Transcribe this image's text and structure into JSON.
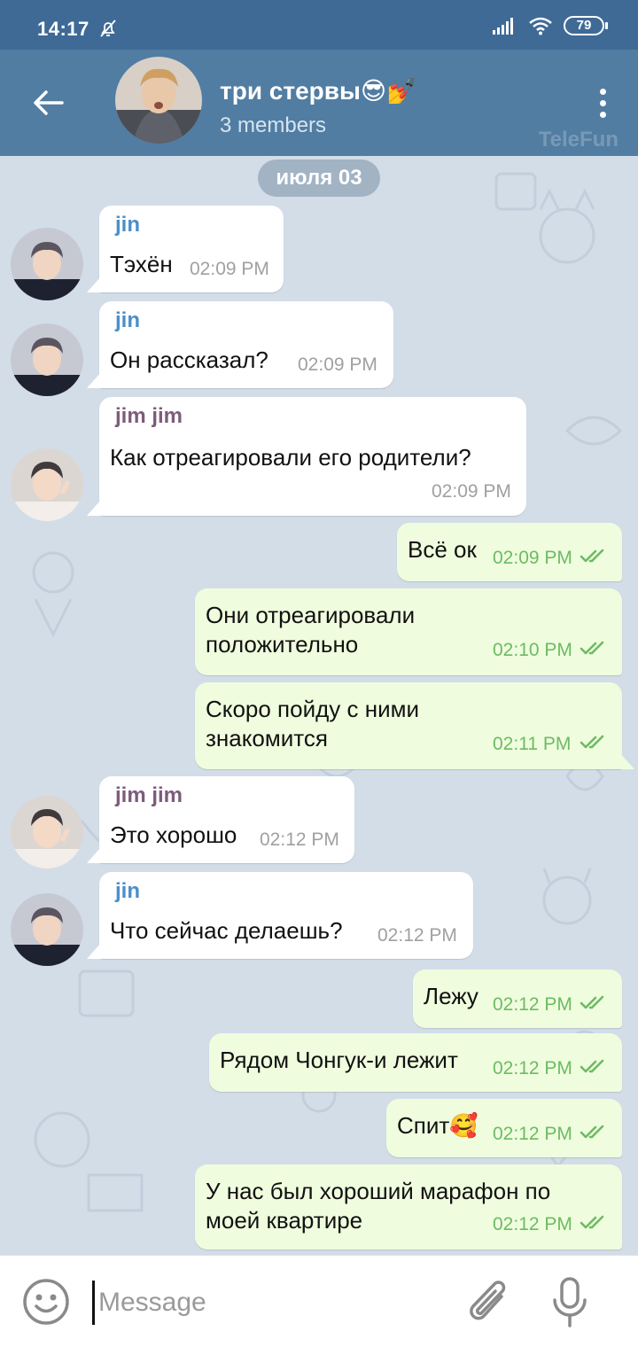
{
  "status_bar": {
    "time": "14:17",
    "battery": "79"
  },
  "header": {
    "title": "три стервы😎💅",
    "subtitle": "3 members",
    "watermark": "TeleFun"
  },
  "chat": {
    "date": "июля 03",
    "messages": [
      {
        "sender": "jin",
        "text": "Тэхён",
        "time": "02:09 PM"
      },
      {
        "sender": "jin",
        "text": "Он рассказал?",
        "time": "02:09 PM"
      },
      {
        "sender": "jim jim",
        "text": "Как отреагировали его родители?",
        "time": "02:09 PM"
      },
      {
        "text": "Всё ок",
        "time": "02:09 PM"
      },
      {
        "text": "Они отреагировали",
        "text2": "положительно",
        "time": "02:10 PM"
      },
      {
        "text": "Скоро пойду с ними",
        "text2": "знакомится",
        "time": "02:11 PM"
      },
      {
        "sender": "jim jim",
        "text": "Это хорошо",
        "time": "02:12 PM"
      },
      {
        "sender": "jin",
        "text": "Что сейчас делаешь?",
        "time": "02:12 PM"
      },
      {
        "text": "Лежу",
        "time": "02:12 PM"
      },
      {
        "text": "Рядом Чонгук-и лежит",
        "time": "02:12 PM"
      },
      {
        "text": "Спит🥰",
        "time": "02:12 PM"
      },
      {
        "text": "У нас был хороший марафон по",
        "text2": "моей квартире",
        "time": "02:12 PM"
      }
    ]
  },
  "input": {
    "placeholder": "Message"
  },
  "colors": {
    "header": "#517da2",
    "status_bar": "#3f6a96",
    "outgoing_bubble": "#effdde",
    "incoming_bubble": "#ffffff",
    "check_marks": "#6dbb63",
    "sender_jin": "#4a8ecb",
    "sender_jim": "#7d5b7a"
  },
  "icons": {
    "back": "arrow-left-icon",
    "more": "more-vertical-icon",
    "mute": "bell-off-icon",
    "emoji": "emoji-icon",
    "attach": "paperclip-icon",
    "mic": "microphone-icon",
    "read": "double-check-icon"
  }
}
